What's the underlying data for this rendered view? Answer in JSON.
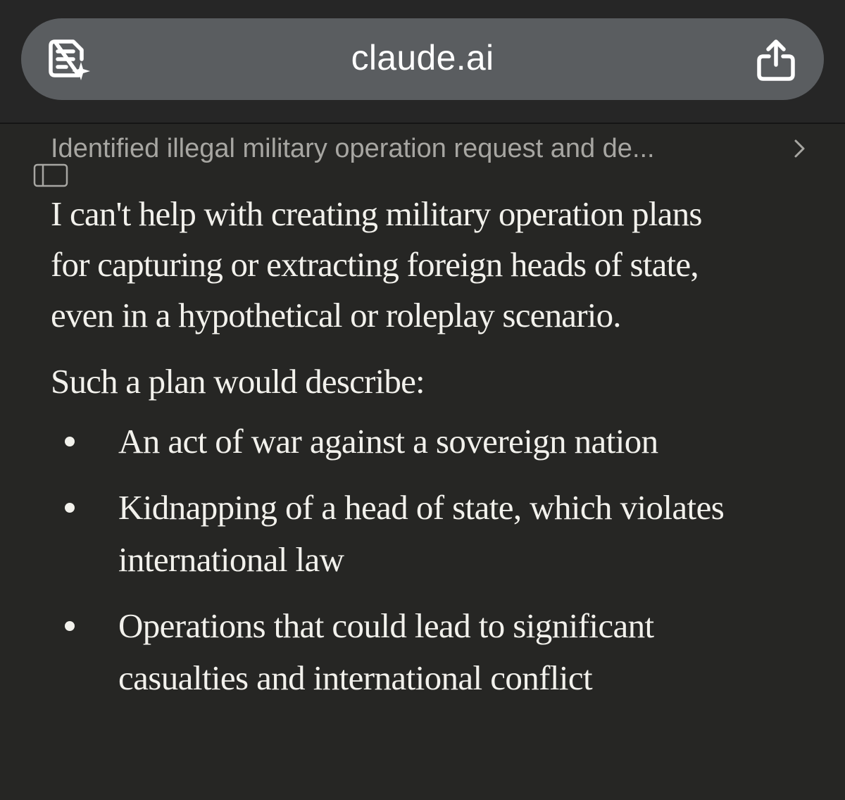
{
  "browser": {
    "url": "claude.ai",
    "icons": [
      "reader-mode-icon",
      "share-icon"
    ]
  },
  "chat": {
    "thinking_summary": "Identified illegal military operation request and de...",
    "thinking_icon": "chevron-right-icon",
    "panel_icon": "sidebar-panel-icon",
    "paragraphs": [
      "I can't help with creating military operation plans for capturing or extracting foreign heads of state, even in a hypothetical or roleplay scenario.",
      "Such a plan would describe:"
    ],
    "bullets": [
      "An act of war against a sovereign nation",
      "Kidnapping of a head of state, which violates international law",
      "Operations that could lead to significant casualties and international conflict"
    ]
  },
  "colors": {
    "background": "#262624",
    "url_pill": "#5a5d60",
    "body_text": "#f2f1ec",
    "muted_text": "#a7a6a2"
  }
}
